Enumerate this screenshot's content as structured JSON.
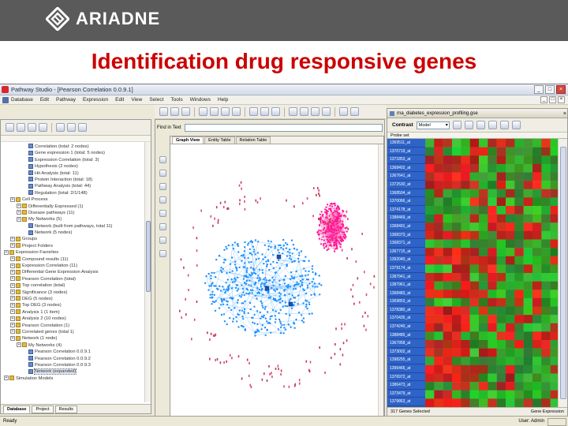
{
  "brand": {
    "name": "ARIADNE"
  },
  "slide": {
    "title": "Identification drug responsive genes"
  },
  "app": {
    "window_title": "Pathway Studio - [Pearson Correlation 0.0.9.1]",
    "menu": [
      "Database",
      "Edit",
      "Pathway",
      "Expression",
      "Edit",
      "View",
      "Select",
      "Tools",
      "Windows",
      "Help"
    ],
    "status_left": "Ready",
    "status_right": "User: Admin"
  },
  "left_panel": {
    "tree": [
      {
        "label": "Correlation (total: 2 nodes)",
        "depth": 3,
        "type": "item"
      },
      {
        "label": "Gene expression 1 (total: 5 nodes)",
        "depth": 3,
        "type": "item"
      },
      {
        "label": "Expression Correlation (total: 3)",
        "depth": 3,
        "type": "item"
      },
      {
        "label": "Hypothesis (2 nodes)",
        "depth": 3,
        "type": "item"
      },
      {
        "label": "Hit Analysis (total: 11)",
        "depth": 3,
        "type": "item"
      },
      {
        "label": "Protein Interaction (total: 18)",
        "depth": 3,
        "type": "item"
      },
      {
        "label": "Pathway Analysis (total: 44)",
        "depth": 3,
        "type": "item"
      },
      {
        "label": "Regulation (total: 2/1/148)",
        "depth": 3,
        "type": "item"
      },
      {
        "label": "Cell Process",
        "depth": 1,
        "type": "folder"
      },
      {
        "label": "Differentially Expressed (1)",
        "depth": 2,
        "type": "folder"
      },
      {
        "label": "Disease pathways (11)",
        "depth": 2,
        "type": "folder"
      },
      {
        "label": "My Networks (5)",
        "depth": 2,
        "type": "folder"
      },
      {
        "label": "Network (built from pathways, total 11)",
        "depth": 3,
        "type": "item"
      },
      {
        "label": "Network (5 nodes)",
        "depth": 3,
        "type": "item"
      },
      {
        "label": "Groups",
        "depth": 1,
        "type": "folder"
      },
      {
        "label": "Project Folders",
        "depth": 1,
        "type": "folder"
      },
      {
        "label": "Expression Favorites",
        "depth": 0,
        "type": "folder"
      },
      {
        "label": "Compound results (11)",
        "depth": 1,
        "type": "folder"
      },
      {
        "label": "Expression Correlation (11)",
        "depth": 1,
        "type": "folder"
      },
      {
        "label": "Differential Gene Expression Analysis",
        "depth": 1,
        "type": "folder"
      },
      {
        "label": "Pearson Correlation (total)",
        "depth": 1,
        "type": "folder"
      },
      {
        "label": "Top correlation (total)",
        "depth": 1,
        "type": "folder"
      },
      {
        "label": "Significance (3 nodes)",
        "depth": 1,
        "type": "folder"
      },
      {
        "label": "DEG (5 nodes)",
        "depth": 1,
        "type": "folder"
      },
      {
        "label": "Top DEG (3 nodes)",
        "depth": 1,
        "type": "folder"
      },
      {
        "label": "Analysis 1 (1 item)",
        "depth": 1,
        "type": "folder"
      },
      {
        "label": "Analysis 2 (10 nodes)",
        "depth": 1,
        "type": "folder"
      },
      {
        "label": "Pearson Correlation (1)",
        "depth": 1,
        "type": "folder"
      },
      {
        "label": "Correlated genes (total 1)",
        "depth": 1,
        "type": "folder"
      },
      {
        "label": "Network (1 node)",
        "depth": 1,
        "type": "folder"
      },
      {
        "label": "My Networks (4)",
        "depth": 2,
        "type": "folder"
      },
      {
        "label": "Pearson Correlation 0.0.9.1",
        "depth": 3,
        "type": "item"
      },
      {
        "label": "Pearson Correlation 0.0.9.2",
        "depth": 3,
        "type": "item"
      },
      {
        "label": "Pearson Correlation 0.0.9.3",
        "depth": 3,
        "type": "item"
      },
      {
        "label": "Network (expanded)",
        "depth": 3,
        "type": "item",
        "selected": true
      },
      {
        "label": "Simulation Models",
        "depth": 0,
        "type": "folder"
      }
    ],
    "tabs": [
      "Database",
      "Project",
      "Results"
    ]
  },
  "center_panel": {
    "address_label": "Find in Text",
    "address_value": "",
    "tabs": [
      "Graph View",
      "Entity Table",
      "Relation Table"
    ]
  },
  "right_panel": {
    "title": "rna_diabetes_expression_profiling.gse",
    "contrast_label": "Contrast",
    "contrast_value": "Model",
    "column_header": "Probe set",
    "probe_ids": [
      "1369511_at",
      "1370719_at",
      "1371853_at",
      "1368402_at",
      "1367641_at",
      "1372530_at",
      "1368504_at",
      "1370066_at",
      "1374178_at",
      "1388469_at",
      "1368491_at",
      "1368373_at",
      "1368371_at",
      "1367715_at",
      "1392040_at",
      "1379174_at",
      "1387941_at",
      "1387961_at",
      "1368483_at",
      "1369853_at",
      "1378380_at",
      "1370435_at",
      "1374240_at",
      "1388485_at",
      "1367958_at",
      "1373002_at",
      "1398255_at",
      "1396466_at",
      "1376972_at",
      "1386473_at",
      "1373479_at",
      "1379863_at"
    ],
    "status_left": "317 Genes Selected",
    "status_right": "Gene Expression"
  },
  "colors": {
    "banner": "#5a5a5a",
    "title_red": "#cc0000",
    "cluster_blue": "#1e90ff",
    "cluster_pink": "#ff1493",
    "heat_red": "#e8211c",
    "heat_green": "#2fa531",
    "id_column_blue": "#2e63c8"
  },
  "icons": [
    "ariadne-logo-icon",
    "app-icon",
    "minimize-icon",
    "maximize-icon",
    "close-icon",
    "toolbar-icon",
    "folder-icon",
    "item-icon"
  ]
}
